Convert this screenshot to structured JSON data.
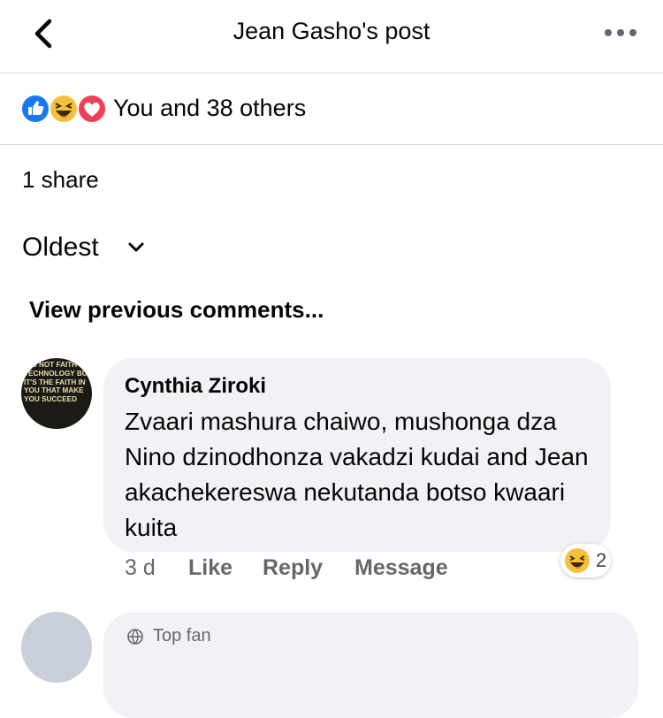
{
  "header": {
    "title": "Jean Gasho's post"
  },
  "reactions": {
    "summary": "You and 38 others",
    "icons": [
      "like-icon",
      "haha-icon",
      "love-icon"
    ]
  },
  "shares": {
    "label": "1 share"
  },
  "sort": {
    "label": "Oldest"
  },
  "comments": {
    "view_previous": "View previous comments...",
    "items": [
      {
        "author": "Cynthia Ziroki",
        "avatar_text": "IT'S NOT FAITH IN TECHNOLOGY BUT IT'S THE FAITH IN YOU THAT MAKE YOU SUCCEED",
        "text": "Zvaari mashura chaiwo, mushonga dza Nino dzinodhonza vakadzi kudai and Jean akachekereswa nekutanda botso kwaari kuita",
        "time": "3 d",
        "actions": {
          "like": "Like",
          "reply": "Reply",
          "message": "Message"
        },
        "reaction": {
          "icon": "haha-icon",
          "count": "2"
        }
      },
      {
        "badge": "Top fan"
      }
    ]
  },
  "colors": {
    "like_blue": "#1877f2",
    "love_red": "#f33e58",
    "haha_yellow": "#f7c03c",
    "bubble_gray": "#f0f2f5",
    "secondary_text": "#65676b"
  }
}
